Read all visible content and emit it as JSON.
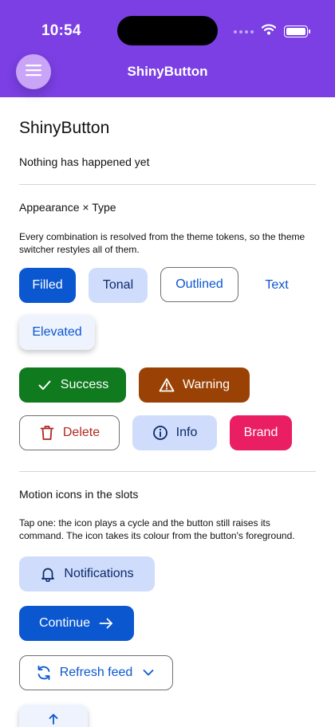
{
  "status_bar": {
    "time": "10:54"
  },
  "app_bar": {
    "title": "ShinyButton",
    "menu_icon": "hamburger-menu-icon"
  },
  "page": {
    "title": "ShinyButton",
    "status_message": "Nothing has happened yet"
  },
  "sections": {
    "appearance": {
      "title": "Appearance × Type",
      "description": "Every combination is resolved from the theme tokens, so the theme switcher restyles all of them.",
      "buttons": {
        "filled": "Filled",
        "tonal": "Tonal",
        "outlined": "Outlined",
        "text": "Text",
        "elevated": "Elevated",
        "success": "Success",
        "warning": "Warning",
        "delete": "Delete",
        "info": "Info",
        "brand": "Brand"
      }
    },
    "motion": {
      "title": "Motion icons in the slots",
      "description": "Tap one: the icon plays a cycle and the button still raises its command. The icon takes its colour from the button's foreground.",
      "buttons": {
        "notifications": "Notifications",
        "continue": "Continue",
        "refresh": "Refresh feed"
      }
    }
  },
  "colors": {
    "primary": "#7b3fe4",
    "filled": "#0b57d0",
    "tonal": "#cfdcfb",
    "success": "#0f7a1e",
    "warning": "#9a4205",
    "danger": "#b3261e",
    "brand": "#e91e63"
  }
}
